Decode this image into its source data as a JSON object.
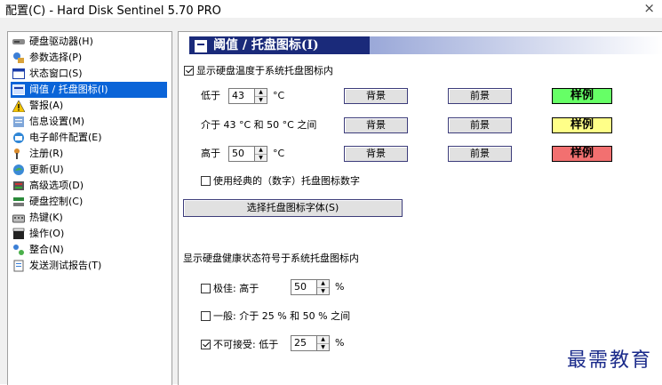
{
  "window": {
    "title": "配置(C) - Hard Disk Sentinel 5.70 PRO",
    "close_glyph": "×"
  },
  "sidebar": {
    "items": [
      {
        "label": "硬盘驱动器(H)",
        "icon": "disk-drive-icon",
        "selected": false
      },
      {
        "label": "参数选择(P)",
        "icon": "preferences-icon",
        "selected": false
      },
      {
        "label": "状态窗口(S)",
        "icon": "window-icon",
        "selected": false
      },
      {
        "label": "阈值 / 托盘图标(I)",
        "icon": "tray-icon",
        "selected": true
      },
      {
        "label": "警报(A)",
        "icon": "warning-icon",
        "selected": false
      },
      {
        "label": "信息设置(M)",
        "icon": "info-icon",
        "selected": false
      },
      {
        "label": "电子邮件配置(E)",
        "icon": "email-icon",
        "selected": false
      },
      {
        "label": "注册(R)",
        "icon": "register-icon",
        "selected": false
      },
      {
        "label": "更新(U)",
        "icon": "update-icon",
        "selected": false
      },
      {
        "label": "高级选项(D)",
        "icon": "advanced-icon",
        "selected": false
      },
      {
        "label": "硬盘控制(C)",
        "icon": "disk-control-icon",
        "selected": false
      },
      {
        "label": "热键(K)",
        "icon": "hotkey-icon",
        "selected": false
      },
      {
        "label": "操作(O)",
        "icon": "action-icon",
        "selected": false
      },
      {
        "label": "整合(N)",
        "icon": "integration-icon",
        "selected": false
      },
      {
        "label": "发送测试报告(T)",
        "icon": "report-icon",
        "selected": false
      }
    ]
  },
  "panel": {
    "header": "阈值 / 托盘图标(I)",
    "show_temp": {
      "label": "显示硬盘温度于系统托盘图标内",
      "checked": true
    },
    "temp_rows": [
      {
        "prefix": "低于",
        "value": "43",
        "unit": "°C",
        "bg_label": "背景",
        "fg_label": "前景",
        "sample": "样例",
        "sample_color": "#66ff66"
      },
      {
        "prefix": "介于 43 °C 和 50 °C 之间",
        "bg_label": "背景",
        "fg_label": "前景",
        "sample": "样例",
        "sample_color": "#ffff88"
      },
      {
        "prefix": "高于",
        "value": "50",
        "unit": "°C",
        "bg_label": "背景",
        "fg_label": "前景",
        "sample": "样例",
        "sample_color": "#f27070"
      }
    ],
    "classic_digits": {
      "label": "使用经典的（数字）托盘图标数字",
      "checked": false
    },
    "font_button": "选择托盘图标字体(S)",
    "health_title": "显示硬盘健康状态符号于系统托盘图标内",
    "health_rows": [
      {
        "label": "极佳: 高于",
        "checked": false,
        "value": "50",
        "unit": "%"
      },
      {
        "label": "一般: 介于 25 % 和 50 % 之间",
        "checked": false
      },
      {
        "label": "不可接受: 低于",
        "checked": true,
        "value": "25",
        "unit": "%"
      }
    ]
  },
  "watermark": "最需教育"
}
